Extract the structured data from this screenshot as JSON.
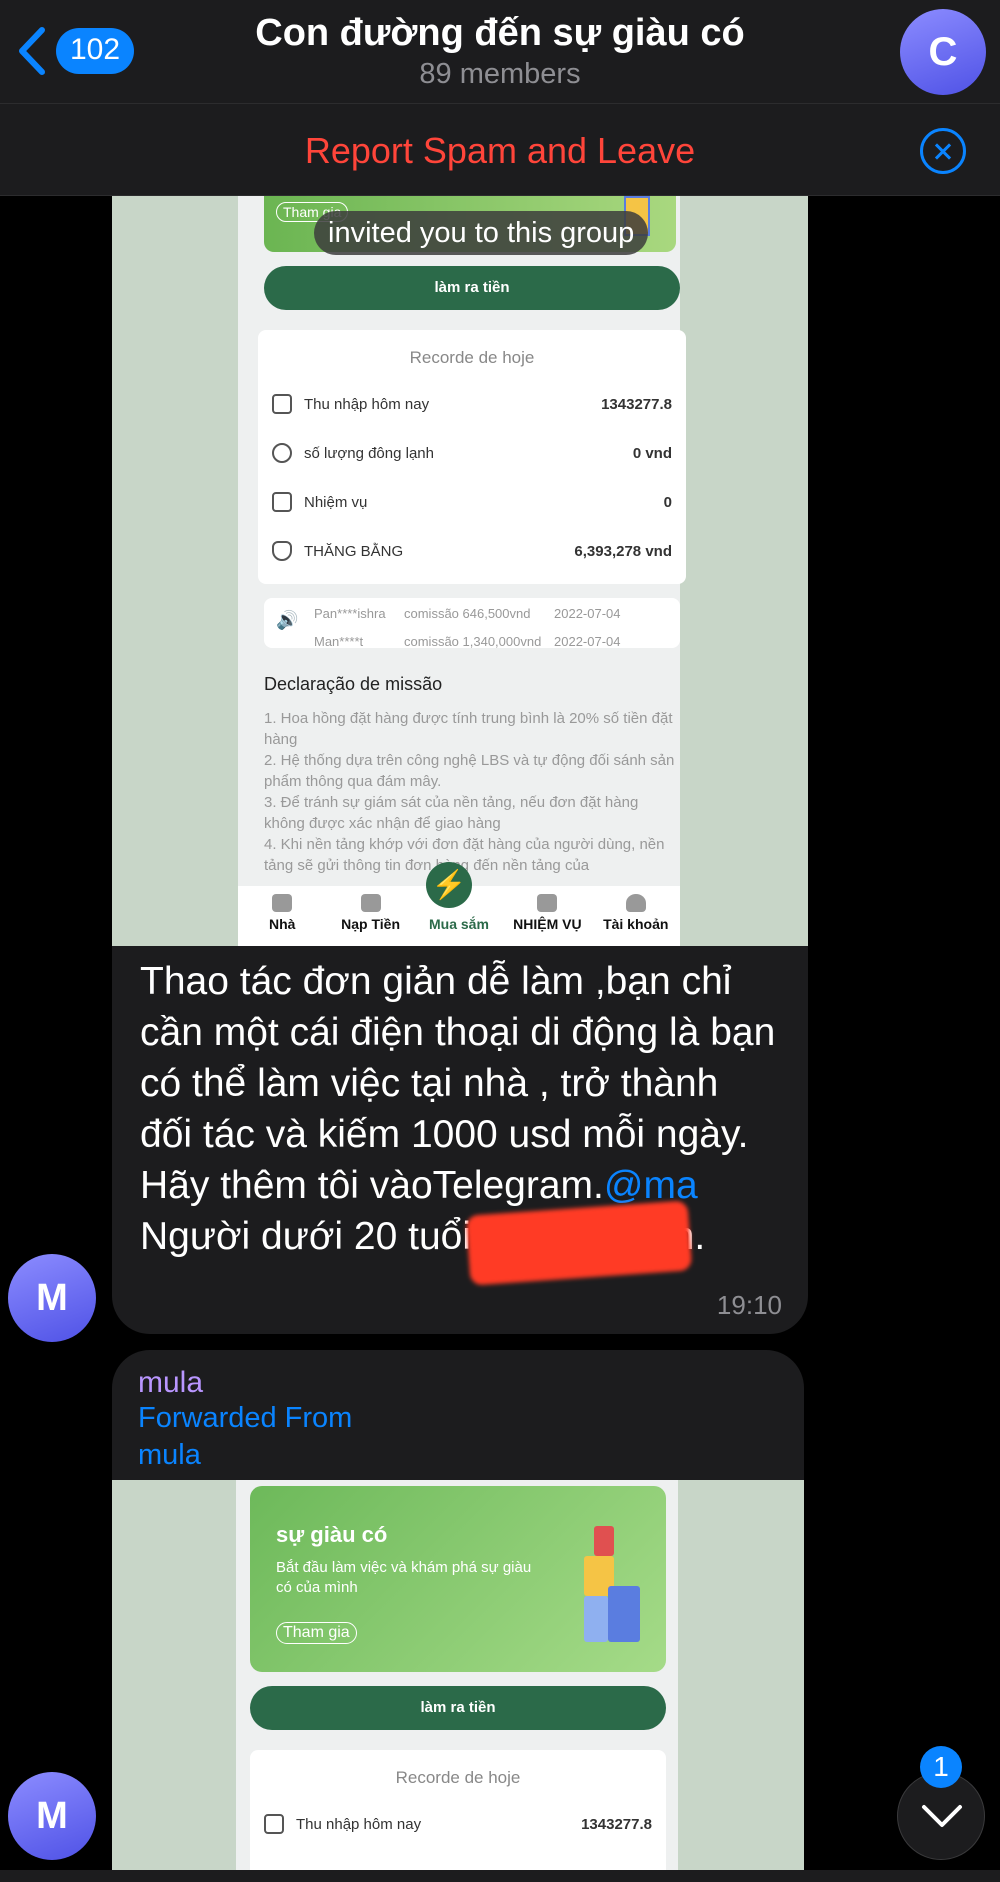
{
  "header": {
    "back_count": "102",
    "title": "Con đường đến sự giàu có",
    "subtitle": "89 members",
    "avatar_letter": "C"
  },
  "spam_bar": {
    "label": "Report Spam and Leave"
  },
  "service_message": "invited you to this group",
  "message1": {
    "screenshot": {
      "banner_button": "Tham gia",
      "action_button": "làm ra tiền",
      "card_title": "Recorde de hoje",
      "rows": [
        {
          "icon": "wallet-icon",
          "label": "Thu nhập hôm nay",
          "value": "1343277.8"
        },
        {
          "icon": "coins-icon",
          "label": "số lượng đông lạnh",
          "value": "0 vnd"
        },
        {
          "icon": "task-icon",
          "label": "Nhiệm vụ",
          "value": "0"
        },
        {
          "icon": "moneybag-icon",
          "label": "THĂNG BẰNG",
          "value": "6,393,278 vnd"
        }
      ],
      "ticker": [
        {
          "user": "Pan****ishra",
          "commission": "comissão 646,500vnd",
          "date": "2022-07-04"
        },
        {
          "user": "Man****t",
          "commission": "comissão 1,340,000vnd",
          "date": "2022-07-04"
        }
      ],
      "declaration_title": "Declaração de missão",
      "declaration_text": "1. Hoa hồng đặt hàng được tính trung bình là 20% số tiền đặt hàng\n2. Hệ thống dựa trên công nghệ LBS và tự động đối sánh sản phẩm thông qua đám mây.\n3. Để tránh sự giám sát của nền tảng, nếu đơn đặt hàng không được xác nhận để giao hàng\n4. Khi nền tảng khớp với đơn đặt hàng của người dùng, nền tảng sẽ gửi thông tin đơn hàng đến nền tảng của",
      "tabs": [
        "Nhà",
        "Nạp Tiền",
        "Mua sắm",
        "NHIỆM VỤ",
        "Tài khoản"
      ]
    },
    "text_main": "Thao tác đơn giản dễ làm ,bạn chỉ cần một cái điện thoại di động là bạn có thể làm việc tại nhà , trở thành đối tác và kiếm 1000 usd mỗi ngày. Hãy thêm tôi vàoTelegram.",
    "mention": "@ma",
    "text_end": "Người dưới 20 tuổi không phiền.",
    "time": "19:10",
    "avatar_letter": "M"
  },
  "message2": {
    "sender": "mula",
    "forwarded_label": "Forwarded From",
    "forwarded_name": "mula",
    "screenshot": {
      "hero_title": "sự giàu có",
      "hero_desc": "Bắt đầu làm việc và khám phá sự giàu có của mình",
      "hero_button": "Tham gia",
      "action_button": "làm ra tiền",
      "card_title": "Recorde de hoje",
      "row_label": "Thu nhập hôm nay",
      "row_value": "1343277.8"
    },
    "avatar_letter": "M"
  },
  "scroll": {
    "unread_count": "1"
  },
  "colors": {
    "accent": "#0a84ff",
    "danger": "#ff453a",
    "bubble": "#1c1c1e",
    "app_green": "#2b6a49"
  }
}
